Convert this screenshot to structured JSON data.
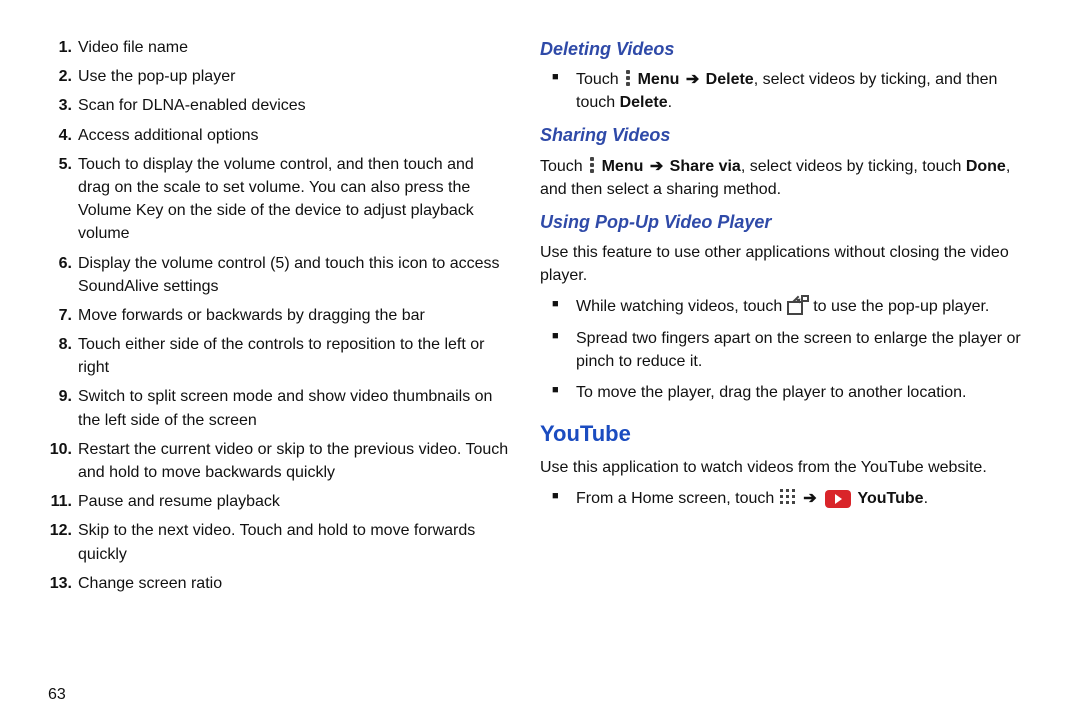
{
  "page_number": "63",
  "left": {
    "items": [
      {
        "num": "1.",
        "text": "Video file name"
      },
      {
        "num": "2.",
        "text": "Use the pop-up player"
      },
      {
        "num": "3.",
        "text": "Scan for DLNA-enabled devices"
      },
      {
        "num": "4.",
        "text": "Access additional options"
      },
      {
        "num": "5.",
        "text": "Touch to display the volume control, and then touch and drag on the scale to set volume. You can also press the Volume Key on the side of the device to adjust playback volume"
      },
      {
        "num": "6.",
        "text": "Display the volume control (5) and touch this icon to access SoundAlive settings"
      },
      {
        "num": "7.",
        "text": "Move forwards or backwards by dragging the bar"
      },
      {
        "num": "8.",
        "text": "Touch either side of the controls to reposition to the left or right"
      },
      {
        "num": "9.",
        "text": "Switch to split screen mode and show video thumbnails on the left side of the screen"
      },
      {
        "num": "10.",
        "text": "Restart the current video or skip to the previous video. Touch and hold to move backwards quickly"
      },
      {
        "num": "11.",
        "text": "Pause and resume playback"
      },
      {
        "num": "12.",
        "text": "Skip to the next video. Touch and hold to move forwards quickly"
      },
      {
        "num": "13.",
        "text": "Change screen ratio"
      }
    ]
  },
  "right": {
    "deleting": {
      "heading": "Deleting Videos",
      "bullet": {
        "pre": "Touch ",
        "menu_bold": " Menu ",
        "arrow": "➔",
        "delete_bold": " Delete",
        "mid": ", select videos by ticking, and then touch ",
        "delete2_bold": "Delete",
        "post": "."
      }
    },
    "sharing": {
      "heading": "Sharing Videos",
      "para": {
        "pre": "Touch ",
        "menu_bold": " Menu ",
        "arrow": "➔",
        "share_bold": " Share via",
        "mid": ", select videos by ticking, touch ",
        "done_bold": "Done",
        "post": ", and then select a sharing method."
      }
    },
    "popup": {
      "heading": "Using Pop-Up Video Player",
      "para": "Use this feature to use other applications without closing the video player.",
      "b1_pre": "While watching videos, touch ",
      "b1_post": " to use the pop-up player.",
      "b2": "Spread two fingers apart on the screen to enlarge the player or pinch to reduce it.",
      "b3": "To move the player, drag the player to another location."
    },
    "youtube": {
      "heading": "YouTube",
      "para": "Use this application to watch videos from the YouTube website.",
      "bullet_pre": "From a Home screen, touch ",
      "arrow": "➔",
      "label": " YouTube",
      "post": "."
    }
  }
}
